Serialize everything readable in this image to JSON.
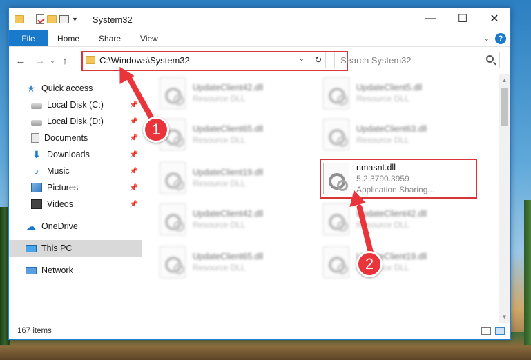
{
  "window": {
    "title": "System32",
    "controls": {
      "minimize": "—",
      "maximize": "☐",
      "close": "✕"
    }
  },
  "ribbon": {
    "tabs": [
      "File",
      "Home",
      "Share",
      "View"
    ],
    "help": "?"
  },
  "address": {
    "path": "C:\\Windows\\System32",
    "search_placeholder": "Search System32"
  },
  "nav": {
    "quick_access": "Quick access",
    "items": [
      {
        "label": "Local Disk (C:)",
        "icon": "drive-icon"
      },
      {
        "label": "Local Disk (D:)",
        "icon": "drive-icon"
      },
      {
        "label": "Documents",
        "icon": "documents-icon"
      },
      {
        "label": "Downloads",
        "icon": "downloads-icon"
      },
      {
        "label": "Music",
        "icon": "music-icon"
      },
      {
        "label": "Pictures",
        "icon": "pictures-icon"
      },
      {
        "label": "Videos",
        "icon": "videos-icon"
      }
    ],
    "onedrive": "OneDrive",
    "this_pc": "This PC",
    "network": "Network"
  },
  "files": [
    {
      "name": "UpdateClient42.dll",
      "desc": "Resource DLL",
      "blurred": true
    },
    {
      "name": "UpdateClient5.dll",
      "desc": "Resource DLL",
      "blurred": true
    },
    {
      "name": "UpdateClient65.dll",
      "desc": "Resource DLL",
      "blurred": true
    },
    {
      "name": "UpdateClient63.dll",
      "desc": "Resource DLL",
      "blurred": true
    },
    {
      "name": "UpdateClient19.dll",
      "desc": "Resource DLL",
      "blurred": true
    },
    {
      "name": "nmasnt.dll",
      "version": "5.2.3790.3959",
      "desc": "Application Sharing...",
      "blurred": false
    },
    {
      "name": "UpdateClient42.dll",
      "desc": "Resource DLL",
      "blurred": true
    },
    {
      "name": "UpdateClient42.dll",
      "desc": "Resource DLL",
      "blurred": true
    },
    {
      "name": "UpdateClient65.dll",
      "desc": "Resource DLL",
      "blurred": true
    },
    {
      "name": "UpdateClient19.dll",
      "desc": "Resource DLL",
      "blurred": true
    }
  ],
  "status": {
    "count": "167 items"
  },
  "annotations": {
    "step1": "1",
    "step2": "2",
    "color": "#e9343b"
  }
}
